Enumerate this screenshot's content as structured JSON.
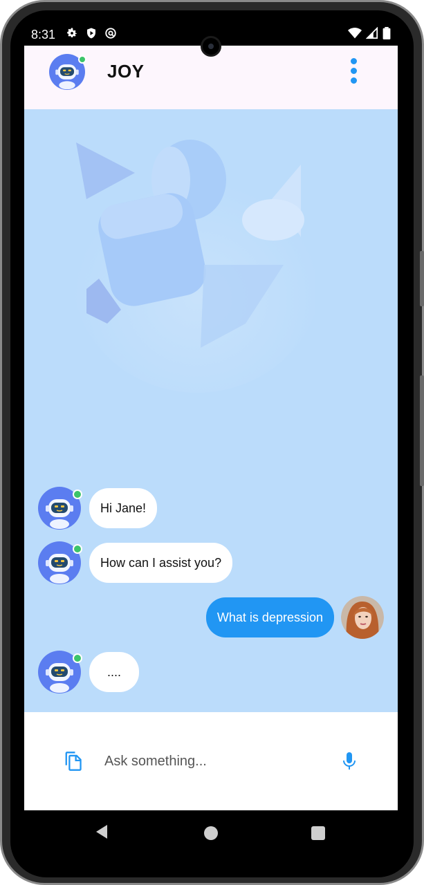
{
  "status_bar": {
    "time": "8:31",
    "left_icons": [
      "gear-icon",
      "shield-play-icon",
      "at-sync-icon"
    ],
    "right_icons": [
      "wifi-icon",
      "signal-icon",
      "battery-icon"
    ]
  },
  "header": {
    "title": "JOY",
    "avatar_icon": "robot-icon",
    "online": true,
    "menu_icon": "more-vertical-icon"
  },
  "messages": [
    {
      "sender": "bot",
      "text": "Hi Jane!"
    },
    {
      "sender": "bot",
      "text": "How can I assist you?"
    },
    {
      "sender": "user",
      "text": "What is depression"
    },
    {
      "sender": "bot",
      "text": "...."
    }
  ],
  "input": {
    "placeholder": "Ask something...",
    "value": "",
    "attach_icon": "copy-icon",
    "mic_icon": "mic-icon"
  },
  "colors": {
    "accent": "#2196f3",
    "chat_background": "#bbdcfb",
    "header_background": "#fdf6fd",
    "online": "#3cc46a"
  }
}
